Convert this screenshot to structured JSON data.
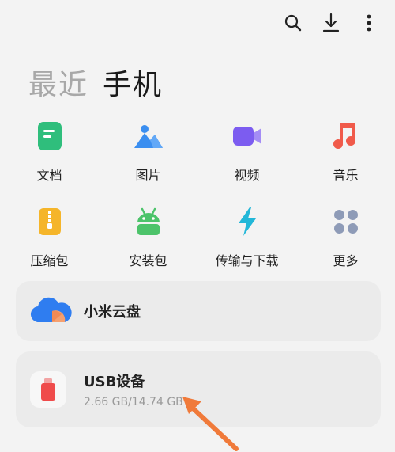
{
  "tabs": [
    {
      "label": "最近",
      "active": false
    },
    {
      "label": "手机",
      "active": true
    }
  ],
  "toolbar": {
    "icons": [
      "search-icon",
      "download-icon",
      "more-vertical-icon"
    ]
  },
  "categories": [
    {
      "label": "文档",
      "icon": "document-icon",
      "color": "#2fbe7c"
    },
    {
      "label": "图片",
      "icon": "image-icon",
      "color": "#3a8ef0"
    },
    {
      "label": "视频",
      "icon": "video-icon",
      "color": "#7c5cf0"
    },
    {
      "label": "音乐",
      "icon": "music-icon",
      "color": "#f05a4a"
    },
    {
      "label": "压缩包",
      "icon": "archive-icon",
      "color": "#f5b52a"
    },
    {
      "label": "安装包",
      "icon": "android-icon",
      "color": "#4cc36a"
    },
    {
      "label": "传输与下载",
      "icon": "transfer-icon",
      "color": "#22b7d8"
    },
    {
      "label": "更多",
      "icon": "more-grid-icon",
      "color": "#8e9bb7"
    }
  ],
  "cloud": {
    "title": "小米云盘"
  },
  "usb": {
    "title": "USB设备",
    "usage": "2.66 GB/14.74 GB"
  },
  "colors": {
    "background": "#f3f3f3",
    "card": "#ebebeb",
    "arrow": "#f07a3a"
  }
}
